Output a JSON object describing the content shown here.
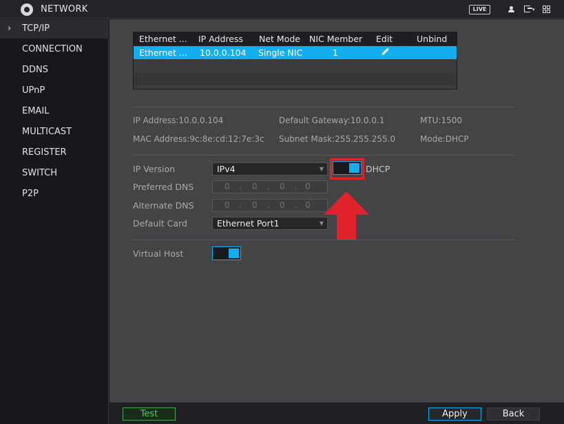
{
  "header": {
    "title": "NETWORK",
    "live_label": "LIVE"
  },
  "sidebar": {
    "items": [
      {
        "label": "TCP/IP",
        "active": true
      },
      {
        "label": "CONNECTION"
      },
      {
        "label": "DDNS"
      },
      {
        "label": "UPnP"
      },
      {
        "label": "EMAIL"
      },
      {
        "label": "MULTICAST"
      },
      {
        "label": "REGISTER"
      },
      {
        "label": "SWITCH"
      },
      {
        "label": "P2P"
      }
    ]
  },
  "table": {
    "headers": [
      "Ethernet ...",
      "IP Address",
      "Net Mode",
      "NIC Member",
      "Edit",
      "Unbind"
    ],
    "rows": [
      {
        "ethernet": "Ethernet ...",
        "ip": "10.0.0.104",
        "mode": "Single NIC",
        "member": "1",
        "edit_icon": "pencil-icon",
        "selected": true
      }
    ]
  },
  "info": {
    "ip_address": "IP Address:10.0.0.104",
    "default_gateway": "Default Gateway:10.0.0.1",
    "mtu": "MTU:1500",
    "mac_address": "MAC Address:9c:8e:cd:12:7e:3c",
    "subnet_mask": "Subnet Mask:255.255.255.0",
    "mode": "Mode:DHCP"
  },
  "form": {
    "ip_version_label": "IP Version",
    "ip_version_value": "IPv4",
    "dhcp_label": "DHCP",
    "dhcp_enabled": true,
    "preferred_dns_label": "Preferred DNS",
    "preferred_dns_value": [
      "0",
      "0",
      "0",
      "0"
    ],
    "alternate_dns_label": "Alternate DNS",
    "alternate_dns_value": [
      "0",
      "0",
      "0",
      "0"
    ],
    "default_card_label": "Default Card",
    "default_card_value": "Ethernet Port1",
    "virtual_host_label": "Virtual Host",
    "virtual_host_enabled": true
  },
  "footer": {
    "test_label": "Test",
    "apply_label": "Apply",
    "back_label": "Back"
  },
  "colors": {
    "accent": "#11aef2",
    "highlight": "#e0232a",
    "test_green": "#58c45f"
  }
}
